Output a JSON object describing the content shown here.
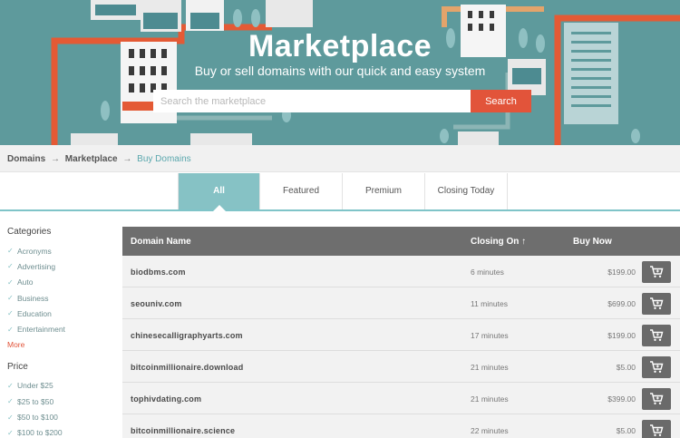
{
  "hero": {
    "title": "Marketplace",
    "subtitle": "Buy or sell domains with our quick and easy system",
    "search_placeholder": "Search the marketplace",
    "search_button": "Search"
  },
  "breadcrumb": {
    "items": [
      "Domains",
      "Marketplace"
    ],
    "separator": "→",
    "current": "Buy Domains"
  },
  "tabs": [
    {
      "label": "All",
      "active": true
    },
    {
      "label": "Featured",
      "active": false
    },
    {
      "label": "Premium",
      "active": false
    },
    {
      "label": "Closing Today",
      "active": false
    }
  ],
  "sidebar": {
    "categories_heading": "Categories",
    "categories": [
      "Acronyms",
      "Advertising",
      "Auto",
      "Business",
      "Education",
      "Entertainment"
    ],
    "more_label": "More",
    "price_heading": "Price",
    "prices": [
      "Under $25",
      "$25 to $50",
      "$50 to $100",
      "$100 to $200"
    ]
  },
  "table": {
    "headers": {
      "domain": "Domain Name",
      "closing": "Closing On ↑",
      "buy": "Buy Now"
    },
    "rows": [
      {
        "domain": "biodbms.com",
        "closing": "6 minutes",
        "price": "$199.00"
      },
      {
        "domain": "seouniv.com",
        "closing": "11 minutes",
        "price": "$699.00"
      },
      {
        "domain": "chinesecalligraphyarts.com",
        "closing": "17 minutes",
        "price": "$199.00"
      },
      {
        "domain": "bitcoinmillionaire.download",
        "closing": "21 minutes",
        "price": "$5.00"
      },
      {
        "domain": "tophivdating.com",
        "closing": "21 minutes",
        "price": "$399.00"
      },
      {
        "domain": "bitcoinmillionaire.science",
        "closing": "22 minutes",
        "price": "$5.00"
      }
    ]
  },
  "colors": {
    "hero_bg": "#5e9a9c",
    "accent": "#e2543a",
    "tab_active": "#86c2c5",
    "table_header": "#6e6e6e"
  },
  "icons": {
    "cart": "cart-icon",
    "check": "check-icon"
  }
}
